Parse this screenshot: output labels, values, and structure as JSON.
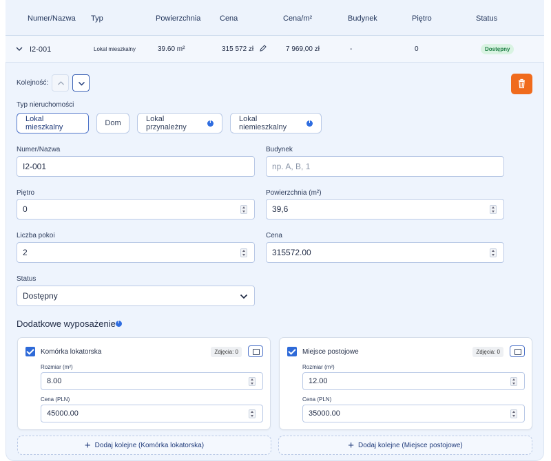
{
  "table": {
    "headers": [
      "Numer/Nazwa",
      "Typ",
      "Powierzchnia",
      "Cena",
      "Cena/m²",
      "Budynek",
      "Piętro",
      "Status"
    ],
    "row": {
      "numer": "I2-001",
      "typ": "Lokal mieszkalny",
      "powierzchnia": "39.60 m²",
      "cena": "315 572 zł",
      "cena_m2": "7 969,00 zł",
      "budynek": "-",
      "pietro": "0",
      "status": "Dostępny"
    }
  },
  "form": {
    "order_label": "Kolejność:",
    "property_type_label": "Typ nieruchomości",
    "property_types": [
      "Lokal mieszkalny",
      "Dom",
      "Lokal przynależny",
      "Lokal niemieszkalny"
    ],
    "active_type": "Lokal mieszkalny",
    "numer_label": "Numer/Nazwa",
    "numer_value": "I2-001",
    "budynek_label": "Budynek",
    "budynek_placeholder": "np. A, B, 1",
    "pietro_label": "Piętro",
    "pietro_value": "0",
    "powierzchnia_label": "Powierzchnia (m²)",
    "powierzchnia_value": "39,6",
    "pokoje_label": "Liczba pokoi",
    "pokoje_value": "2",
    "cena_label": "Cena",
    "cena_value": "315572.00",
    "status_label": "Status",
    "status_value": "Dostępny"
  },
  "extras": {
    "title": "Dodatkowe wyposażenie",
    "cards": [
      {
        "title": "Komórka lokatorska",
        "photos": "Zdjęcia: 0",
        "size_label": "Rozmiar (m²)",
        "size_value": "8.00",
        "price_label": "Cena (PLN)",
        "price_value": "45000.00",
        "add_label": "Dodaj kolejne (Komórka lokatorska)"
      },
      {
        "title": "Miejsce postojowe",
        "photos": "Zdjęcia: 0",
        "size_label": "Rozmiar (m²)",
        "size_value": "12.00",
        "price_label": "Cena (PLN)",
        "price_value": "35000.00",
        "add_label": "Dodaj kolejne (Miejsce postojowe)"
      }
    ]
  },
  "colors": {
    "accent": "#2e6ad8",
    "delete": "#f06b1d",
    "status_bg": "#d9f3e2",
    "status_text": "#1b7d43"
  }
}
